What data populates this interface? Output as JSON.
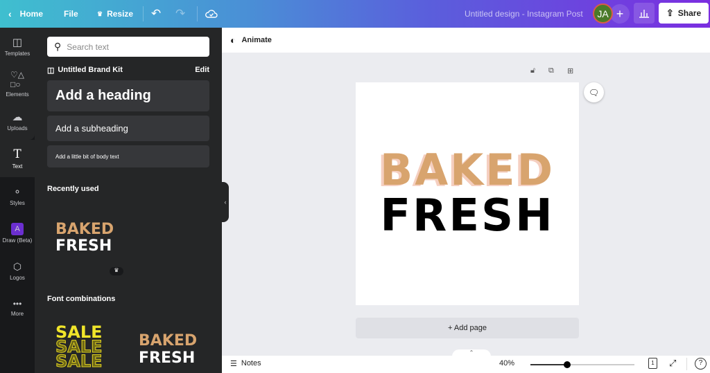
{
  "topbar": {
    "home": "Home",
    "file": "File",
    "resize": "Resize",
    "title": "Untitled design - Instagram Post",
    "avatar_initials": "JA",
    "share": "Share",
    "avatar_color": "#4a7a2a"
  },
  "rail": [
    {
      "label": "Templates",
      "icon": "templates-icon"
    },
    {
      "label": "Elements",
      "icon": "elements-icon"
    },
    {
      "label": "Uploads",
      "icon": "upload-cloud-icon"
    },
    {
      "label": "Text",
      "icon": "text-icon",
      "active": true
    },
    {
      "label": "Styles",
      "icon": "palette-icon"
    },
    {
      "label": "Draw (Beta)",
      "icon": "draw-icon"
    },
    {
      "label": "Logos",
      "icon": "logo-icon"
    },
    {
      "label": "More",
      "icon": "more-icon"
    }
  ],
  "panel": {
    "search_placeholder": "Search text",
    "brand_kit": "Untitled Brand Kit",
    "edit": "Edit",
    "heading": "Add a heading",
    "subheading": "Add a subheading",
    "body": "Add a little bit of body text",
    "recently_used": "Recently used",
    "font_combinations": "Font combinations",
    "recent_item": {
      "line1": "BAKED",
      "line2": "FRESH"
    },
    "combo1": {
      "line1": "SALE",
      "line2": "SALE",
      "line3": "SALE"
    },
    "combo2": {
      "line1": "BAKED",
      "line2": "FRESH"
    }
  },
  "toolbar": {
    "animate": "Animate"
  },
  "canvas": {
    "line1": "BAKED",
    "line2": "FRESH",
    "line1_color": "#d8a46e",
    "shadow_color": "#f5cfc0"
  },
  "add_page": "+ Add page",
  "footer": {
    "notes": "Notes",
    "zoom": "40%",
    "zoom_fraction": 0.35,
    "page_count": "1"
  }
}
